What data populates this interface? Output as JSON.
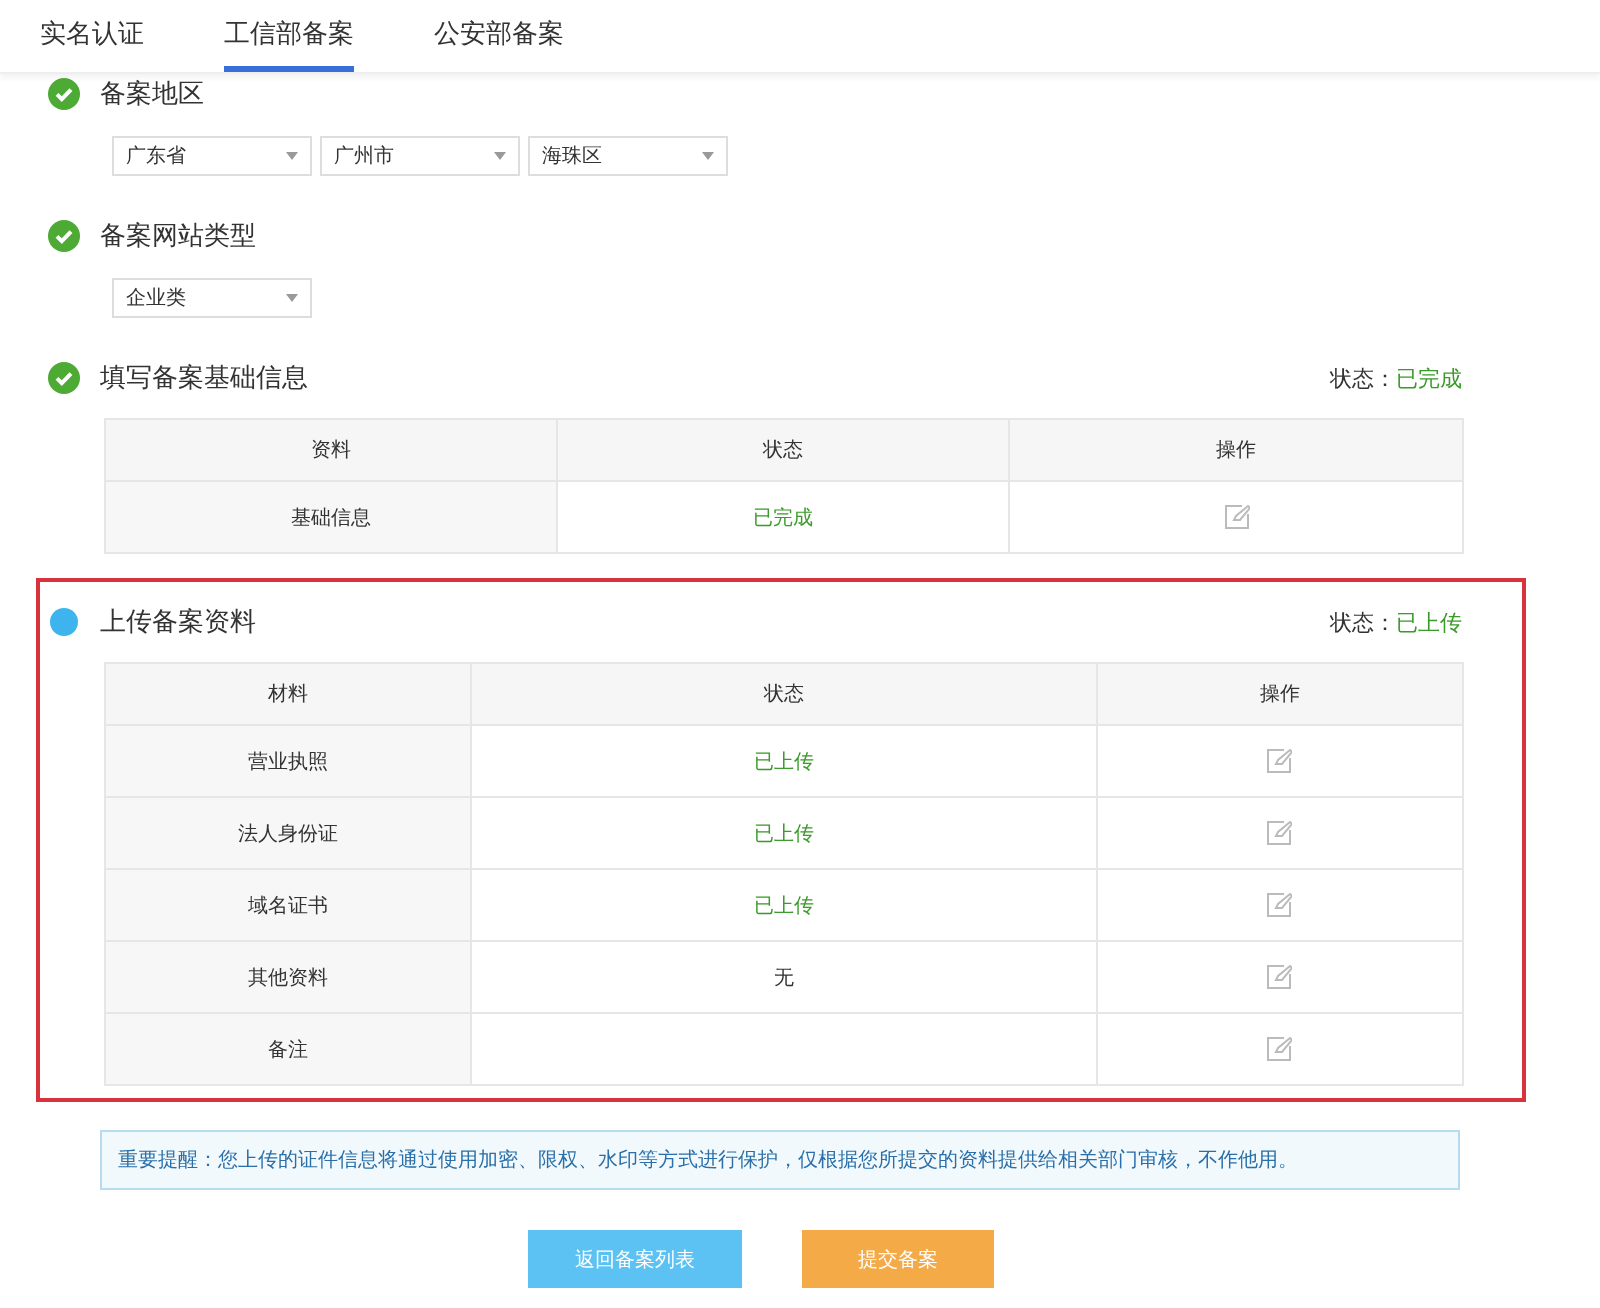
{
  "tabs": [
    {
      "label": "实名认证",
      "selected": false
    },
    {
      "label": "工信部备案",
      "selected": true
    },
    {
      "label": "公安部备案",
      "selected": false
    }
  ],
  "steps": [
    {
      "kind": "done",
      "highlighted": false,
      "title": "备案地区",
      "selects": [
        "广东省",
        "广州市",
        "海珠区"
      ]
    },
    {
      "kind": "done",
      "highlighted": false,
      "title": "备案网站类型",
      "selects": [
        "企业类"
      ]
    },
    {
      "kind": "done",
      "highlighted": false,
      "title": "填写备案基础信息",
      "status_label": "状态：",
      "status_value": "已完成",
      "table": {
        "columns": [
          "资料",
          "状态",
          "操作"
        ],
        "rows": [
          {
            "name": "基础信息",
            "status": "已完成",
            "success": true
          }
        ]
      }
    },
    {
      "kind": "current",
      "highlighted": true,
      "title": "上传备案资料",
      "status_label": "状态：",
      "status_value": "已上传",
      "table": {
        "columns": [
          "材料",
          "状态",
          "操作"
        ],
        "rows": [
          {
            "name": "营业执照",
            "status": "已上传",
            "success": true
          },
          {
            "name": "法人身份证",
            "status": "已上传",
            "success": true
          },
          {
            "name": "域名证书",
            "status": "已上传",
            "success": true
          },
          {
            "name": "其他资料",
            "status": "无",
            "success": false
          },
          {
            "name": "备注"
          }
        ]
      }
    }
  ],
  "notice": "重要提醒：您上传的证件信息将通过使用加密、限权、水印等方式进行保护，仅根据您所提交的资料提供给相关部门审核，不作他用。",
  "buttons": [
    {
      "label": "返回备案列表",
      "kind": "secondary"
    },
    {
      "label": "提交备案",
      "kind": "primary"
    }
  ]
}
